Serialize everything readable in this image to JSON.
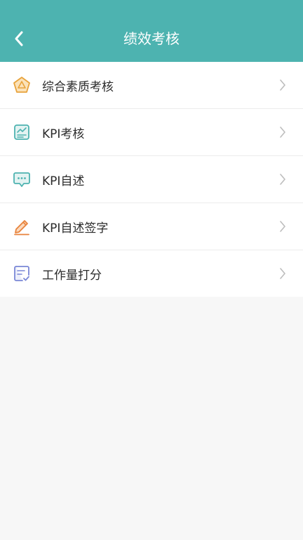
{
  "header": {
    "title": "绩效考核",
    "back_icon": "chevron-left-icon",
    "background_color": "#4db3b0"
  },
  "menu": {
    "items": [
      {
        "label": "综合素质考核",
        "icon": "pentagon-badge-icon",
        "icon_color": "#e8a33c"
      },
      {
        "label": "KPI考核",
        "icon": "chart-board-icon",
        "icon_color": "#4db3b0"
      },
      {
        "label": "KPI自述",
        "icon": "chat-bubble-icon",
        "icon_color": "#4db3b0"
      },
      {
        "label": "KPI自述签字",
        "icon": "pen-sign-icon",
        "icon_color": "#e8833c"
      },
      {
        "label": "工作量打分",
        "icon": "checklist-icon",
        "icon_color": "#7a87d6"
      }
    ]
  }
}
